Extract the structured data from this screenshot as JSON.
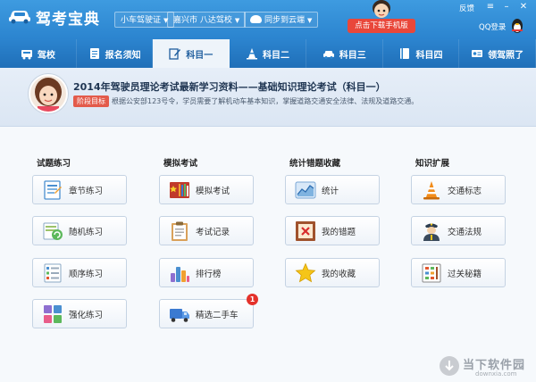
{
  "app": {
    "title": "驾考宝典"
  },
  "titlebar": {
    "license_type": "小车驾驶证",
    "location": "嘉兴市 八达驾校",
    "sync_label": "同步到云端",
    "download_button": "点击下载手机版",
    "feedback": "反馈",
    "qq_login": "QQ登录"
  },
  "nav": {
    "items": [
      {
        "label": "驾校",
        "icon": "school-icon"
      },
      {
        "label": "报名须知",
        "icon": "notice-icon"
      },
      {
        "label": "科目一",
        "icon": "pencil-icon",
        "active": true
      },
      {
        "label": "科目二",
        "icon": "cone-icon"
      },
      {
        "label": "科目三",
        "icon": "car-icon"
      },
      {
        "label": "科目四",
        "icon": "book-icon"
      },
      {
        "label": "领驾照了",
        "icon": "license-icon"
      }
    ]
  },
  "banner": {
    "title": "2014年驾驶员理论考试最新学习资料——基础知识理论考试（科目一）",
    "badge": "阶段目标",
    "description": "根据公安部123号令，学员需要了解机动车基本知识，掌握道路交通安全法律、法规及道路交通。"
  },
  "sections": {
    "practice": {
      "header": "试题练习",
      "tiles": [
        {
          "label": "章节练习",
          "icon": "chapter-icon"
        },
        {
          "label": "随机练习",
          "icon": "random-icon"
        },
        {
          "label": "顺序练习",
          "icon": "sequence-icon"
        },
        {
          "label": "强化练习",
          "icon": "intensive-icon"
        }
      ]
    },
    "mock": {
      "header": "模拟考试",
      "tiles": [
        {
          "label": "模拟考试",
          "icon": "exam-icon"
        },
        {
          "label": "考试记录",
          "icon": "clipboard-icon"
        },
        {
          "label": "排行榜",
          "icon": "ranking-icon"
        },
        {
          "label": "精选二手车",
          "icon": "truck-icon",
          "badge": "1"
        }
      ]
    },
    "stats": {
      "header": "统计错题收藏",
      "tiles": [
        {
          "label": "统计",
          "icon": "chart-icon"
        },
        {
          "label": "我的错题",
          "icon": "mistake-icon"
        },
        {
          "label": "我的收藏",
          "icon": "star-icon"
        }
      ]
    },
    "knowledge": {
      "header": "知识扩展",
      "tiles": [
        {
          "label": "交通标志",
          "icon": "traffic-cone-icon"
        },
        {
          "label": "交通法规",
          "icon": "police-icon"
        },
        {
          "label": "过关秘籍",
          "icon": "abacus-icon"
        }
      ]
    }
  },
  "watermark": {
    "text": "当下软件园",
    "url": "downxia.com"
  },
  "colors": {
    "titlebar": "#2b84cf",
    "nav": "#1f6fb8",
    "accent_red": "#e9473a",
    "tile_border": "#c5d3e3"
  }
}
